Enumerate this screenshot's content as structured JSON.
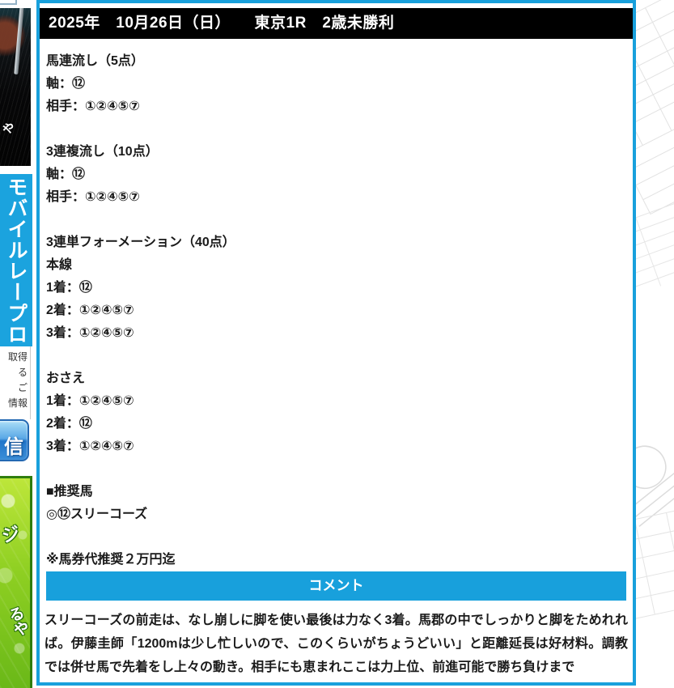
{
  "header": {
    "title": "2025年　10月26日（日）　　東京1R　2歳未勝利"
  },
  "tips": {
    "lines": [
      "馬連流し（5点）",
      "軸：⑫",
      "相手：①②④⑤⑦",
      "",
      "3連複流し（10点）",
      "軸：⑫",
      "相手：①②④⑤⑦",
      "",
      "3連単フォーメーション（40点）",
      "本線",
      "1着：⑫",
      "2着：①②④⑤⑦",
      "3着：①②④⑤⑦",
      "",
      "おさえ",
      "1着：①②④⑤⑦",
      "2着：⑫",
      "3着：①②④⑤⑦",
      "",
      "■推奨馬",
      "◎⑫スリーコーズ",
      "",
      "※馬券代推奨２万円迄"
    ]
  },
  "comment": {
    "button_label": "コメント",
    "body": "スリーコーズの前走は、なし崩しに脚を使い最後は力なく3着。馬郡の中でしっかりと脚をためれれば。伊藤圭師「1200mは少し忙しいので、このくらいがちょうどいい」と距離延長は好材料。調教では併せ馬で先着をし上々の動き。相手にも恵まれここは力上位、前進可能で勝ち負けまで"
  },
  "sidebar": {
    "photo_overlay_text": "や",
    "banner_vertical_text": "モバイルレープロ",
    "info_lines": [
      "取得",
      "る",
      "ご",
      "情報"
    ],
    "send_button_label": "信",
    "green_fragment_top": "ジ",
    "green_fragment_bottom": "るや"
  },
  "colors": {
    "accent_blue": "#18a0dc",
    "header_black": "#000000",
    "sidebar_green": "#8ecf22",
    "glossy_button_blue": "#2176ca"
  }
}
